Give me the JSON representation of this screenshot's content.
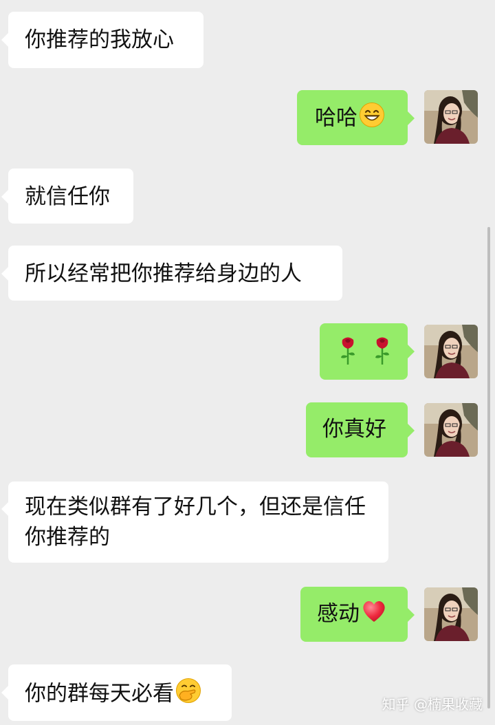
{
  "messages": [
    {
      "side": "in",
      "text": "你推荐的我放心"
    },
    {
      "side": "out",
      "text": "哈哈",
      "emoji": "grinning-face-icon"
    },
    {
      "side": "in",
      "text": "就信任你"
    },
    {
      "side": "in",
      "text": "所以经常把你推荐给身边的人"
    },
    {
      "side": "out",
      "text": "",
      "emoji": "rose-icon"
    },
    {
      "side": "out",
      "text": "你真好"
    },
    {
      "side": "in",
      "text": "现在类似群有了好几个，但还是信任你推荐的"
    },
    {
      "side": "out",
      "text": "感动",
      "emoji": "red-heart-icon"
    },
    {
      "side": "in",
      "text": "你的群每天必看",
      "emoji": "hand-over-mouth-face-icon"
    }
  ],
  "watermark": "知乎 @楠果收藏",
  "colors": {
    "background": "#ededed",
    "incoming_bubble": "#ffffff",
    "outgoing_bubble": "#95ec69"
  }
}
